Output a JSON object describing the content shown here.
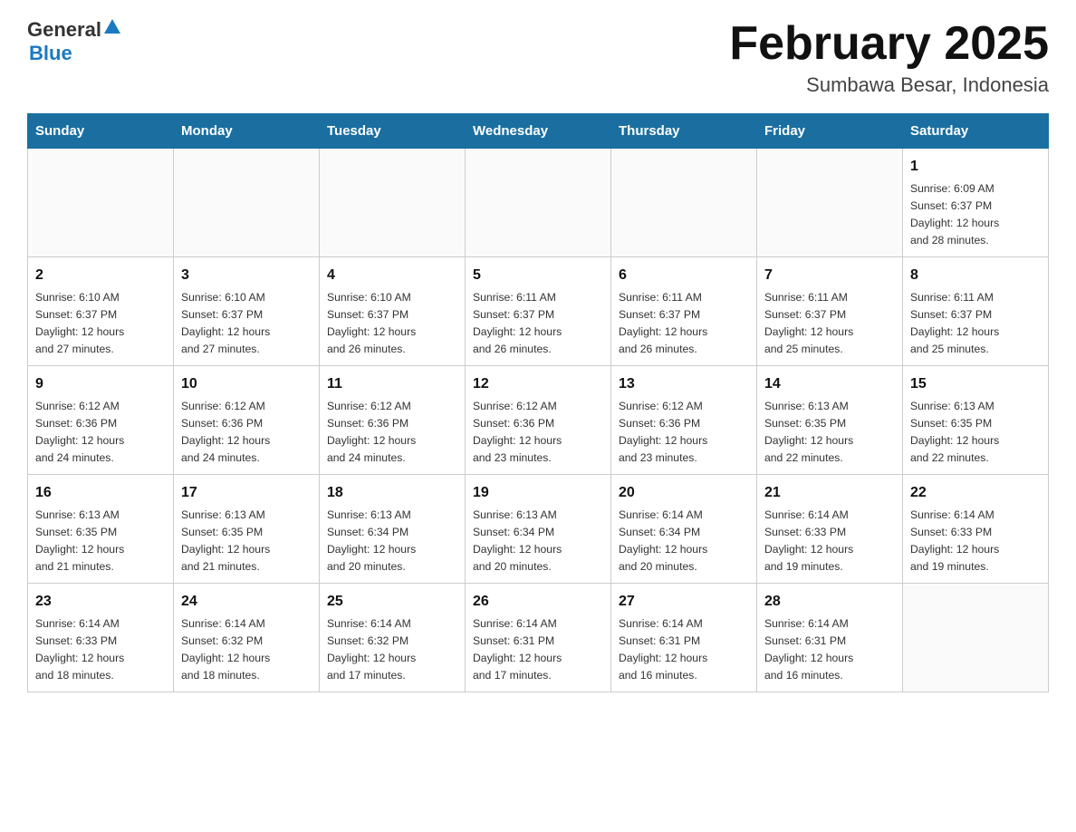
{
  "logo": {
    "text_general": "General",
    "arrow_symbol": "▲",
    "text_blue": "Blue"
  },
  "title": "February 2025",
  "location": "Sumbawa Besar, Indonesia",
  "days_of_week": [
    "Sunday",
    "Monday",
    "Tuesday",
    "Wednesday",
    "Thursday",
    "Friday",
    "Saturday"
  ],
  "weeks": [
    [
      {
        "day": "",
        "info": ""
      },
      {
        "day": "",
        "info": ""
      },
      {
        "day": "",
        "info": ""
      },
      {
        "day": "",
        "info": ""
      },
      {
        "day": "",
        "info": ""
      },
      {
        "day": "",
        "info": ""
      },
      {
        "day": "1",
        "info": "Sunrise: 6:09 AM\nSunset: 6:37 PM\nDaylight: 12 hours\nand 28 minutes."
      }
    ],
    [
      {
        "day": "2",
        "info": "Sunrise: 6:10 AM\nSunset: 6:37 PM\nDaylight: 12 hours\nand 27 minutes."
      },
      {
        "day": "3",
        "info": "Sunrise: 6:10 AM\nSunset: 6:37 PM\nDaylight: 12 hours\nand 27 minutes."
      },
      {
        "day": "4",
        "info": "Sunrise: 6:10 AM\nSunset: 6:37 PM\nDaylight: 12 hours\nand 26 minutes."
      },
      {
        "day": "5",
        "info": "Sunrise: 6:11 AM\nSunset: 6:37 PM\nDaylight: 12 hours\nand 26 minutes."
      },
      {
        "day": "6",
        "info": "Sunrise: 6:11 AM\nSunset: 6:37 PM\nDaylight: 12 hours\nand 26 minutes."
      },
      {
        "day": "7",
        "info": "Sunrise: 6:11 AM\nSunset: 6:37 PM\nDaylight: 12 hours\nand 25 minutes."
      },
      {
        "day": "8",
        "info": "Sunrise: 6:11 AM\nSunset: 6:37 PM\nDaylight: 12 hours\nand 25 minutes."
      }
    ],
    [
      {
        "day": "9",
        "info": "Sunrise: 6:12 AM\nSunset: 6:36 PM\nDaylight: 12 hours\nand 24 minutes."
      },
      {
        "day": "10",
        "info": "Sunrise: 6:12 AM\nSunset: 6:36 PM\nDaylight: 12 hours\nand 24 minutes."
      },
      {
        "day": "11",
        "info": "Sunrise: 6:12 AM\nSunset: 6:36 PM\nDaylight: 12 hours\nand 24 minutes."
      },
      {
        "day": "12",
        "info": "Sunrise: 6:12 AM\nSunset: 6:36 PM\nDaylight: 12 hours\nand 23 minutes."
      },
      {
        "day": "13",
        "info": "Sunrise: 6:12 AM\nSunset: 6:36 PM\nDaylight: 12 hours\nand 23 minutes."
      },
      {
        "day": "14",
        "info": "Sunrise: 6:13 AM\nSunset: 6:35 PM\nDaylight: 12 hours\nand 22 minutes."
      },
      {
        "day": "15",
        "info": "Sunrise: 6:13 AM\nSunset: 6:35 PM\nDaylight: 12 hours\nand 22 minutes."
      }
    ],
    [
      {
        "day": "16",
        "info": "Sunrise: 6:13 AM\nSunset: 6:35 PM\nDaylight: 12 hours\nand 21 minutes."
      },
      {
        "day": "17",
        "info": "Sunrise: 6:13 AM\nSunset: 6:35 PM\nDaylight: 12 hours\nand 21 minutes."
      },
      {
        "day": "18",
        "info": "Sunrise: 6:13 AM\nSunset: 6:34 PM\nDaylight: 12 hours\nand 20 minutes."
      },
      {
        "day": "19",
        "info": "Sunrise: 6:13 AM\nSunset: 6:34 PM\nDaylight: 12 hours\nand 20 minutes."
      },
      {
        "day": "20",
        "info": "Sunrise: 6:14 AM\nSunset: 6:34 PM\nDaylight: 12 hours\nand 20 minutes."
      },
      {
        "day": "21",
        "info": "Sunrise: 6:14 AM\nSunset: 6:33 PM\nDaylight: 12 hours\nand 19 minutes."
      },
      {
        "day": "22",
        "info": "Sunrise: 6:14 AM\nSunset: 6:33 PM\nDaylight: 12 hours\nand 19 minutes."
      }
    ],
    [
      {
        "day": "23",
        "info": "Sunrise: 6:14 AM\nSunset: 6:33 PM\nDaylight: 12 hours\nand 18 minutes."
      },
      {
        "day": "24",
        "info": "Sunrise: 6:14 AM\nSunset: 6:32 PM\nDaylight: 12 hours\nand 18 minutes."
      },
      {
        "day": "25",
        "info": "Sunrise: 6:14 AM\nSunset: 6:32 PM\nDaylight: 12 hours\nand 17 minutes."
      },
      {
        "day": "26",
        "info": "Sunrise: 6:14 AM\nSunset: 6:31 PM\nDaylight: 12 hours\nand 17 minutes."
      },
      {
        "day": "27",
        "info": "Sunrise: 6:14 AM\nSunset: 6:31 PM\nDaylight: 12 hours\nand 16 minutes."
      },
      {
        "day": "28",
        "info": "Sunrise: 6:14 AM\nSunset: 6:31 PM\nDaylight: 12 hours\nand 16 minutes."
      },
      {
        "day": "",
        "info": ""
      }
    ]
  ]
}
